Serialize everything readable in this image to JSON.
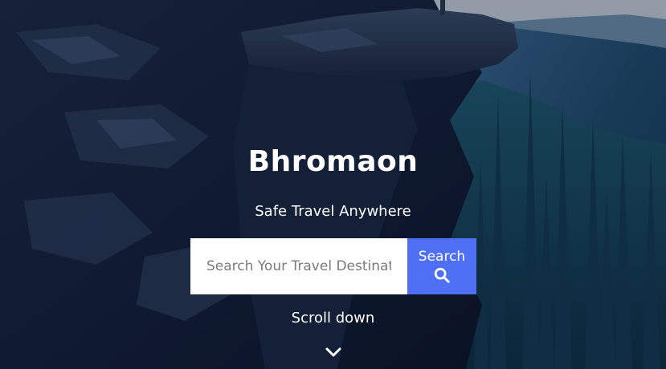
{
  "hero": {
    "title": "Bhromaon",
    "tagline": "Safe Travel Anywhere",
    "background_description": "",
    "search": {
      "placeholder": "Search Your Travel Destination",
      "value": "",
      "button_label": "Search",
      "button_icon": "search-icon"
    },
    "scroll": {
      "label": "Scroll down",
      "icon": "chevron-down-icon"
    }
  },
  "colors": {
    "accent": "#4f6ff5",
    "text": "#ffffff",
    "input_bg": "#ffffff"
  }
}
